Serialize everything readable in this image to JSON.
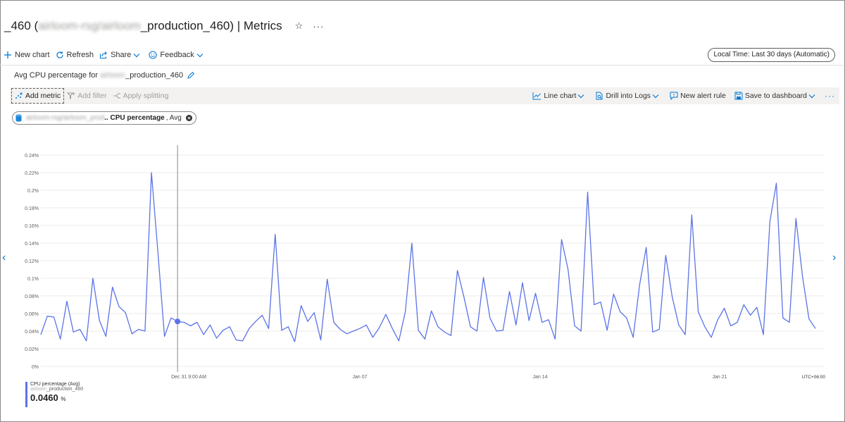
{
  "header": {
    "title_prefix": "_460 (",
    "title_blurred": "airloom-rsg/airloom",
    "title_suffix": "_production_460) | Metrics",
    "star_icon": "☆",
    "more_icon": "···"
  },
  "command_bar": {
    "new_chart": "New chart",
    "refresh": "Refresh",
    "share": "Share",
    "feedback": "Feedback",
    "time_range": "Local Time: Last 30 days (Automatic)"
  },
  "chart_header": {
    "title_prefix": "Avg CPU percentage for",
    "title_blurred": "airloom",
    "title_suffix": "_production_460"
  },
  "metrics_toolbar": {
    "add_metric": "Add metric",
    "add_filter": "Add filter",
    "apply_splitting": "Apply splitting",
    "line_chart": "Line chart",
    "drill_into_logs": "Drill into Logs",
    "new_alert_rule": "New alert rule",
    "save_to_dashboard": "Save to dashboard",
    "more": "···"
  },
  "metric_pill": {
    "resource_blurred": "airloom-rsg/airloom_prod",
    "metric": ".. CPU percentage",
    "aggregation": ", Avg"
  },
  "legend": {
    "series_label": "CPU percentage (Avg)",
    "resource_blurred": "airloom",
    "resource_suffix": "_production_460",
    "value": "0.0460",
    "unit": "%"
  },
  "colors": {
    "series": "#5b73e8",
    "accent": "#0078d4"
  },
  "chart_data": {
    "type": "line",
    "y_ticks": [
      "0.24%",
      "0.22%",
      "0.2%",
      "0.18%",
      "0.16%",
      "0.14%",
      "0.12%",
      "0.1%",
      "0.08%",
      "0.06%",
      "0.04%",
      "0.02%",
      "0%"
    ],
    "y_tick_values": [
      0.24,
      0.22,
      0.2,
      0.18,
      0.16,
      0.14,
      0.12,
      0.1,
      0.08,
      0.06,
      0.04,
      0.02,
      0
    ],
    "ylim": [
      0,
      0.24
    ],
    "x_tick_labels": [
      "Dec 31 9:00 AM",
      "Jan 07",
      "Jan 14",
      "Jan 21"
    ],
    "timezone_label": "UTC+06:00",
    "grid": true,
    "cursor_index": 21,
    "series": [
      {
        "name": "CPU percentage (Avg)",
        "values": [
          0.036,
          0.057,
          0.056,
          0.031,
          0.074,
          0.039,
          0.042,
          0.029,
          0.1,
          0.052,
          0.034,
          0.09,
          0.068,
          0.061,
          0.037,
          0.042,
          0.04,
          0.22,
          0.128,
          0.034,
          0.055,
          0.051,
          0.05,
          0.046,
          0.05,
          0.036,
          0.047,
          0.032,
          0.041,
          0.045,
          0.03,
          0.029,
          0.043,
          0.051,
          0.058,
          0.043,
          0.15,
          0.041,
          0.045,
          0.028,
          0.069,
          0.051,
          0.061,
          0.03,
          0.099,
          0.05,
          0.042,
          0.037,
          0.04,
          0.043,
          0.047,
          0.033,
          0.044,
          0.059,
          0.043,
          0.029,
          0.062,
          0.14,
          0.041,
          0.031,
          0.063,
          0.045,
          0.039,
          0.035,
          0.109,
          0.079,
          0.045,
          0.04,
          0.101,
          0.055,
          0.04,
          0.041,
          0.085,
          0.047,
          0.095,
          0.052,
          0.083,
          0.05,
          0.053,
          0.031,
          0.144,
          0.11,
          0.046,
          0.04,
          0.198,
          0.07,
          0.073,
          0.041,
          0.082,
          0.062,
          0.055,
          0.033,
          0.093,
          0.135,
          0.039,
          0.042,
          0.126,
          0.079,
          0.047,
          0.036,
          0.172,
          0.062,
          0.045,
          0.033,
          0.053,
          0.066,
          0.046,
          0.05,
          0.07,
          0.058,
          0.067,
          0.036,
          0.164,
          0.208,
          0.055,
          0.05,
          0.168,
          0.103,
          0.054,
          0.043
        ]
      }
    ]
  }
}
